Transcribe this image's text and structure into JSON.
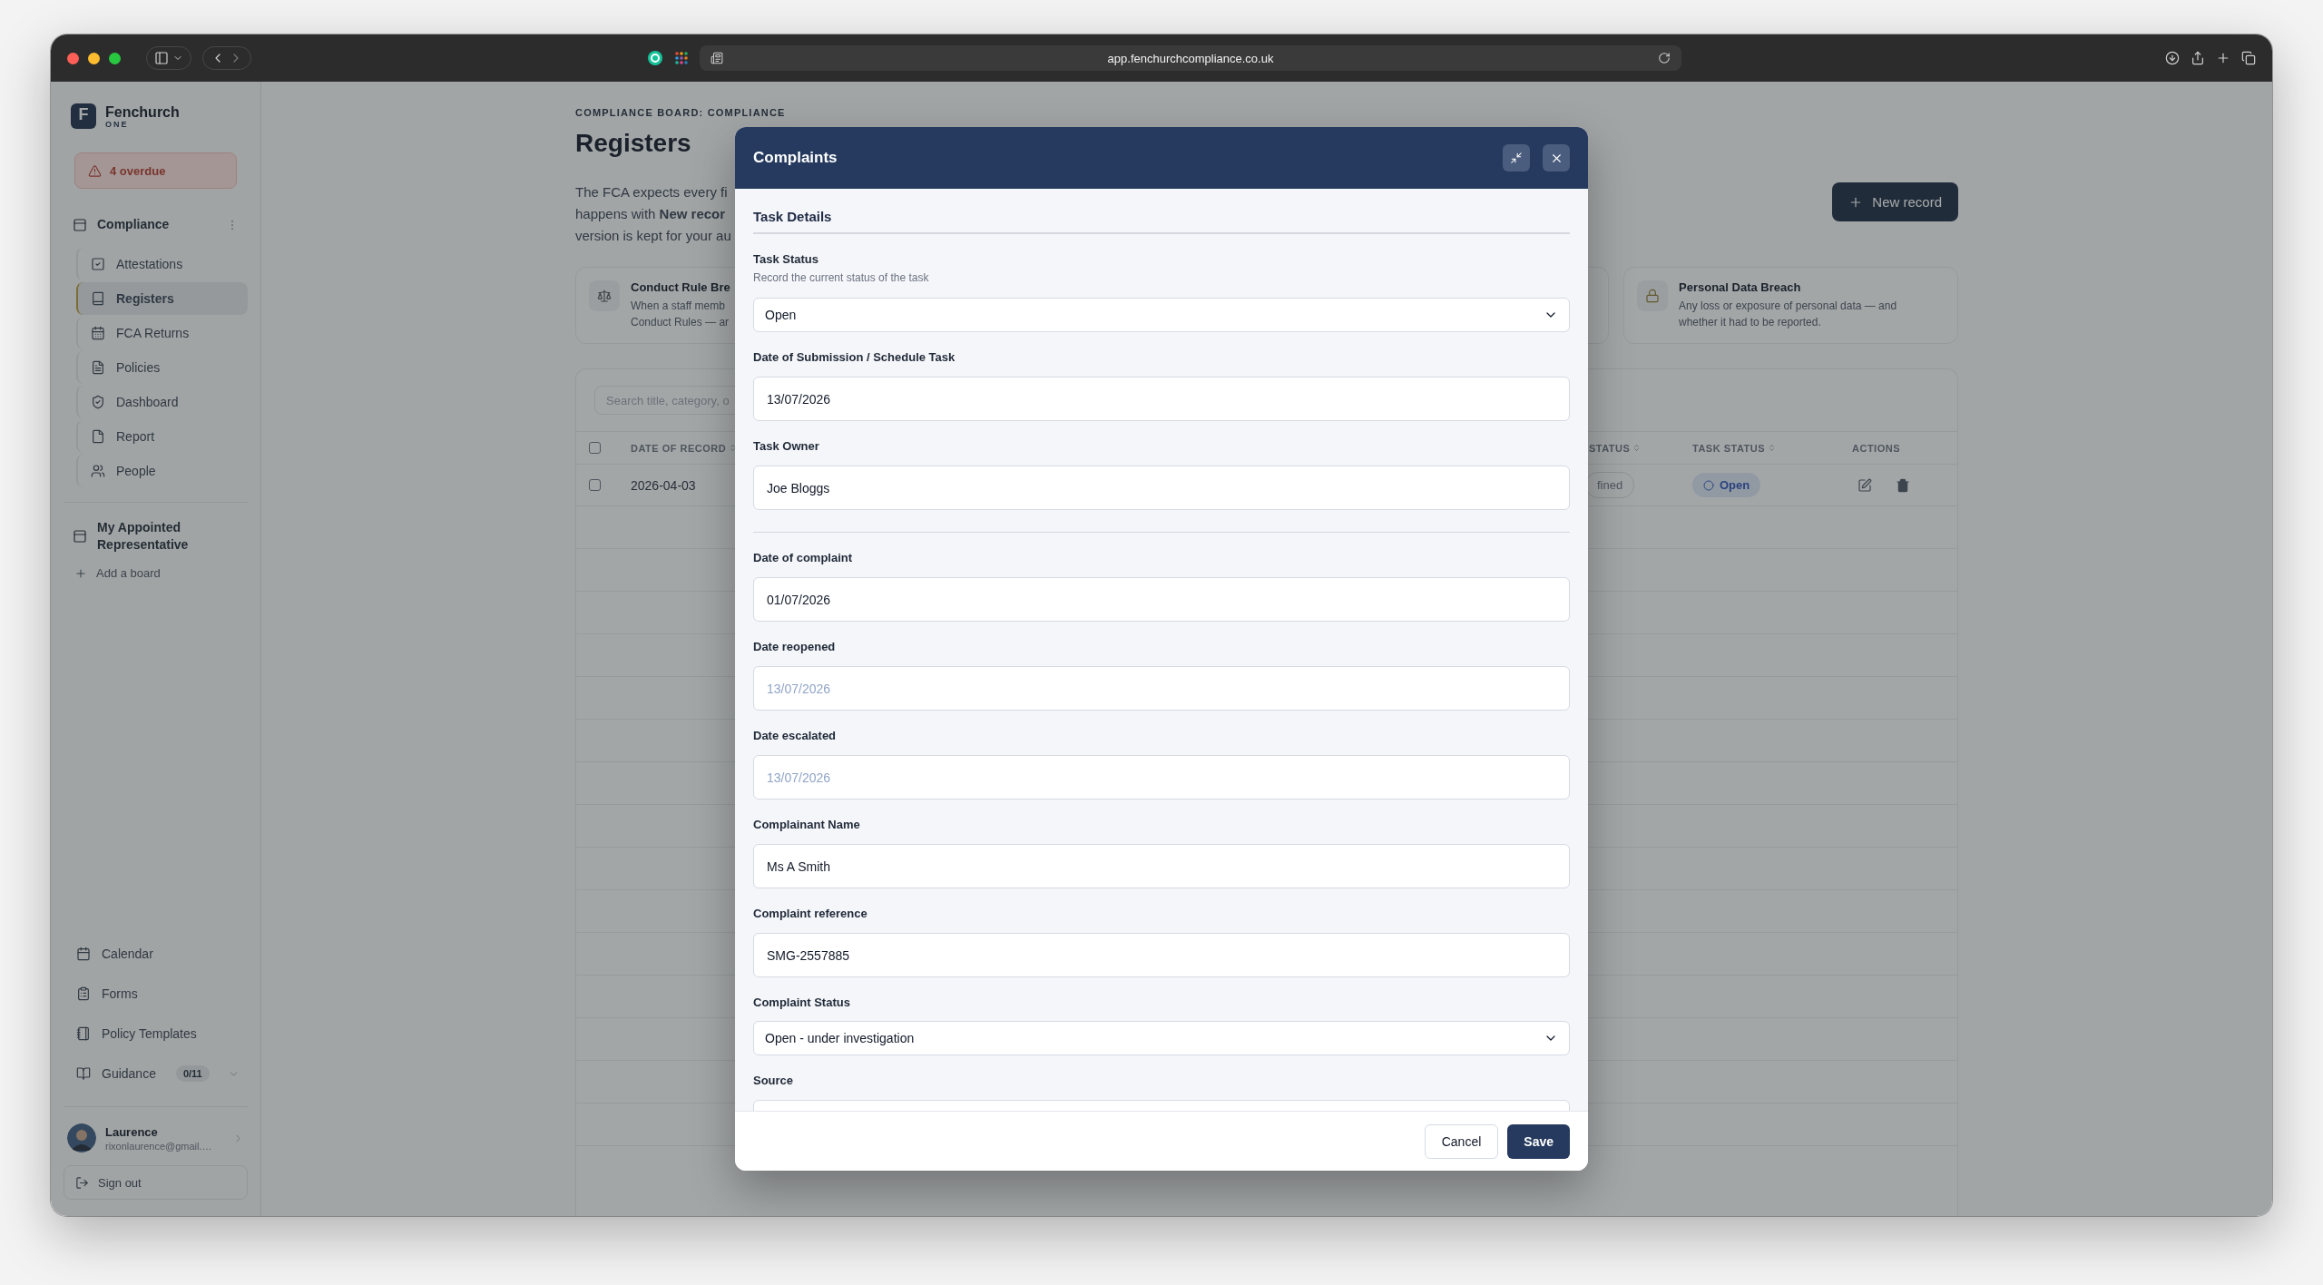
{
  "browser": {
    "url": "app.fenchurchcompliance.co.uk"
  },
  "sidebar": {
    "brand": {
      "logo": "F",
      "name": "Fenchurch",
      "tagline": "ONE"
    },
    "alert": "4 overdue",
    "boards": [
      {
        "title": "Compliance",
        "items": [
          {
            "label": "Attestations",
            "selected": false
          },
          {
            "label": "Registers",
            "selected": true
          },
          {
            "label": "FCA Returns",
            "selected": false
          },
          {
            "label": "Policies",
            "selected": false
          },
          {
            "label": "Dashboard",
            "selected": false
          },
          {
            "label": "Report",
            "selected": false
          },
          {
            "label": "People",
            "selected": false
          }
        ]
      },
      {
        "title": "My Appointed Representative"
      }
    ],
    "add_board": "Add a board",
    "links": [
      {
        "label": "Calendar"
      },
      {
        "label": "Forms"
      },
      {
        "label": "Policy Templates"
      },
      {
        "label": "Guidance",
        "badge": "0/11"
      }
    ],
    "user": {
      "name": "Laurence",
      "email": "rixonlaurence@gmail.…"
    },
    "sign_out": "Sign out"
  },
  "page": {
    "breadcrumb": "COMPLIANCE BOARD: COMPLIANCE",
    "title": "Registers",
    "intro_lines": [
      "The FCA expects every fi",
      "happens with **New recor**",
      "version is kept for your au"
    ],
    "new_record": "New record",
    "cards": [
      {
        "kind": "register",
        "title": "Conduct Rule Bre",
        "lines": [
          "When a staff memb",
          "Conduct Rules — ar"
        ]
      },
      {
        "kind": "blank"
      },
      {
        "kind": "register",
        "title": "Personal Data Breach",
        "lines": [
          "Any loss or exposure of personal data — and",
          "whether it had to be reported."
        ]
      }
    ],
    "search": {
      "placeholder": "Search title, category, o"
    },
    "table": {
      "all_checked": false,
      "columns": [
        {
          "label": "DATE OF RECORD",
          "sortable": true
        },
        {
          "label": "STATUS",
          "sortable": true
        },
        {
          "label": "TASK STATUS",
          "sortable": true
        },
        {
          "label": "ACTIONS",
          "sortable": false
        }
      ],
      "rows": [
        {
          "checked": false,
          "date": "2026-04-03",
          "status": "fined",
          "task_status": "Open"
        }
      ]
    }
  },
  "modal": {
    "title": "Complaints",
    "section": "Task Details",
    "fields": [
      {
        "kind": "select",
        "label": "Task Status",
        "help": "Record the current status of the task",
        "value": "Open"
      },
      {
        "kind": "text",
        "label": "Date of Submission / Schedule Task",
        "value": "13/07/2026"
      },
      {
        "kind": "text",
        "label": "Task Owner",
        "value": "Joe Bloggs"
      },
      {
        "kind": "divider"
      },
      {
        "kind": "text",
        "label": "Date of complaint",
        "value": "01/07/2026"
      },
      {
        "kind": "text",
        "label": "Date reopened",
        "placeholder": "13/07/2026"
      },
      {
        "kind": "text",
        "label": "Date escalated",
        "placeholder": "13/07/2026"
      },
      {
        "kind": "text",
        "label": "Complainant Name",
        "value": "Ms A Smith"
      },
      {
        "kind": "text",
        "label": "Complaint reference",
        "value": "SMG-2557885"
      },
      {
        "kind": "select",
        "label": "Complaint Status",
        "value": "Open - under investigation"
      },
      {
        "kind": "text",
        "label": "Source"
      }
    ],
    "cancel": "Cancel",
    "save": "Save"
  }
}
